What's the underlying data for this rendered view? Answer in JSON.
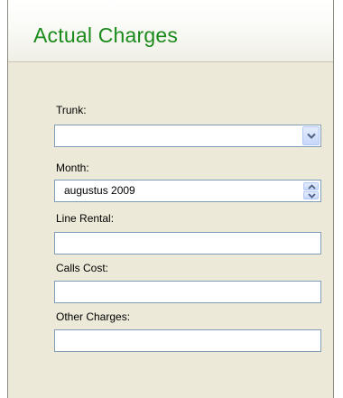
{
  "header": {
    "title": "Actual Charges"
  },
  "form": {
    "trunk": {
      "label": "Trunk:",
      "value": ""
    },
    "month": {
      "label": "Month:",
      "value": "augustus  2009"
    },
    "line_rental": {
      "label": "Line Rental:",
      "value": ""
    },
    "calls_cost": {
      "label": "Calls Cost:",
      "value": ""
    },
    "other_charges": {
      "label": "Other Charges:",
      "value": ""
    }
  },
  "icons": {
    "trunk_dropdown": "chevron-down-icon",
    "month_up": "chevron-up-icon",
    "month_down": "chevron-down-icon"
  },
  "colors": {
    "title": "#1a8a1a",
    "panel_background": "#ece9d8",
    "input_border": "#7f9db9",
    "button_face": "#c8d7f9",
    "arrow": "#4d6185"
  }
}
